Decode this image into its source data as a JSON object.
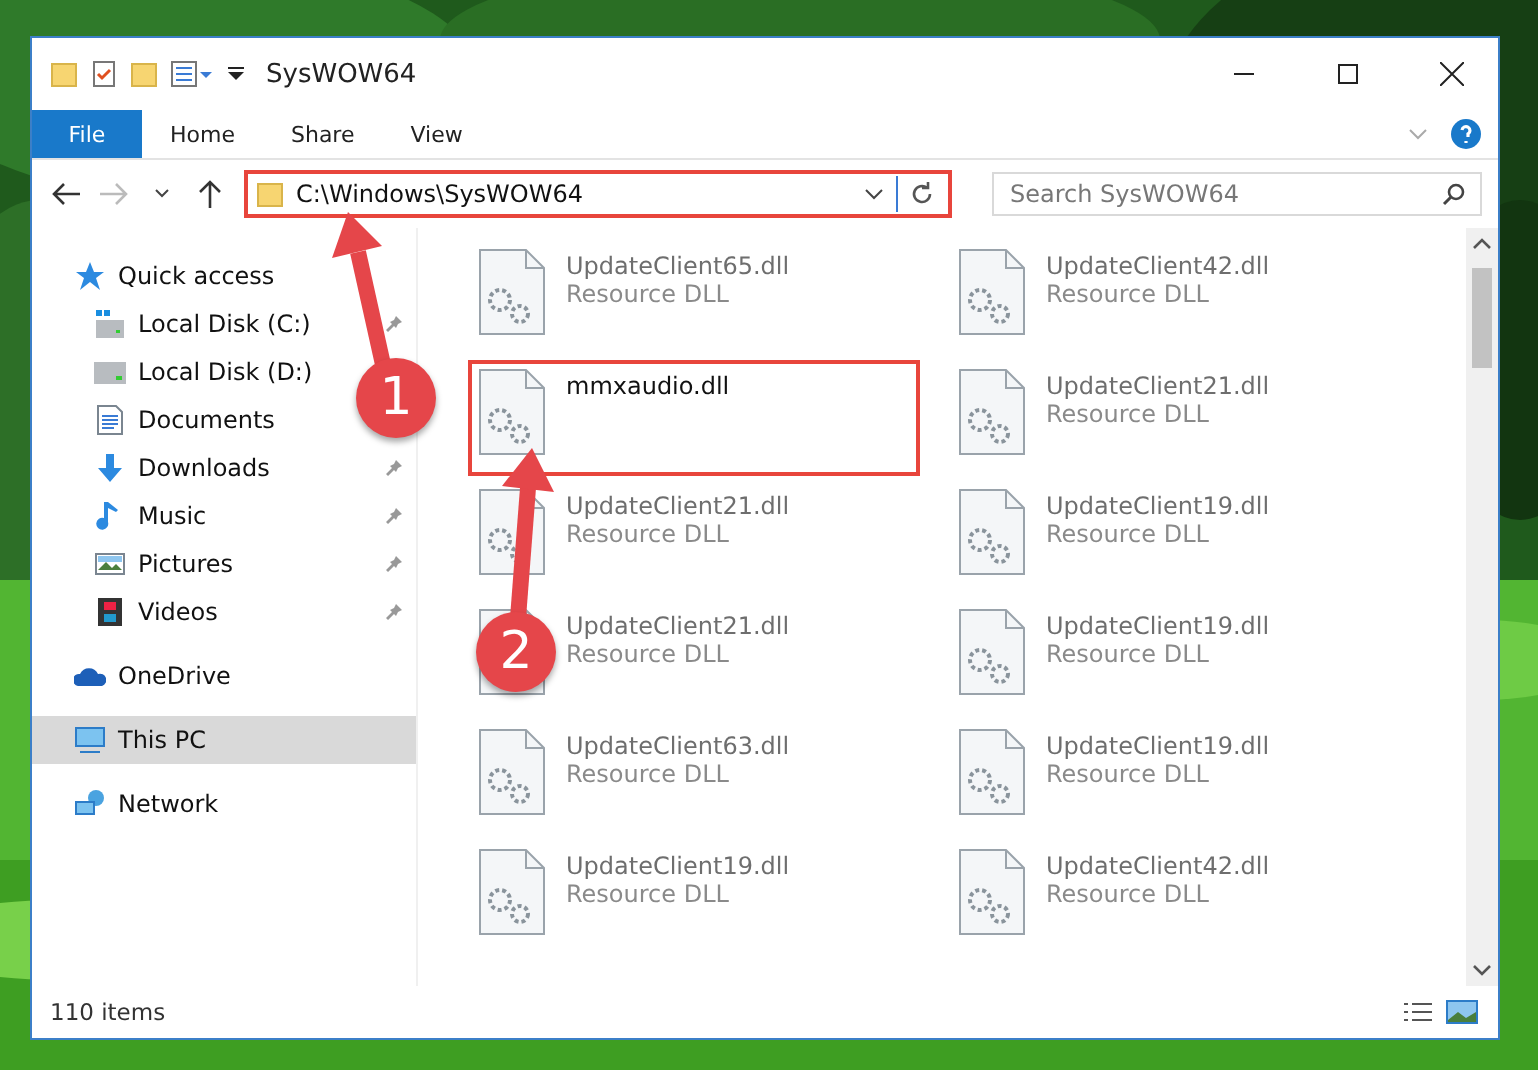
{
  "window": {
    "title": "SysWOW64"
  },
  "ribbon_tabs": [
    {
      "label": "File",
      "selected": true
    },
    {
      "label": "Home",
      "selected": false
    },
    {
      "label": "Share",
      "selected": false
    },
    {
      "label": "View",
      "selected": false
    }
  ],
  "address": {
    "path": "C:\\Windows\\SysWOW64",
    "highlighted": true
  },
  "search": {
    "placeholder": "Search SysWOW64"
  },
  "sidebar": {
    "items": [
      {
        "label": "Quick access",
        "kind": "star",
        "selected": false,
        "children": [
          {
            "label": "Local Disk (C:)",
            "kind": "drive-win",
            "pinned": true
          },
          {
            "label": "Local Disk (D:)",
            "kind": "drive",
            "pinned": false
          },
          {
            "label": "Documents",
            "kind": "document",
            "pinned": false
          },
          {
            "label": "Downloads",
            "kind": "download",
            "pinned": true
          },
          {
            "label": "Music",
            "kind": "music",
            "pinned": true
          },
          {
            "label": "Pictures",
            "kind": "pictures",
            "pinned": true
          },
          {
            "label": "Videos",
            "kind": "videos",
            "pinned": true
          }
        ]
      },
      {
        "label": "OneDrive",
        "kind": "cloud",
        "selected": false
      },
      {
        "label": "This PC",
        "kind": "pc",
        "selected": true
      },
      {
        "label": "Network",
        "kind": "network",
        "selected": false
      }
    ]
  },
  "files": [
    {
      "name": "UpdateClient65.dll",
      "type": "Resource DLL",
      "dimmed": true,
      "highlighted": false
    },
    {
      "name": "UpdateClient42.dll",
      "type": "Resource DLL",
      "dimmed": true,
      "highlighted": false
    },
    {
      "name": "mmxaudio.dll",
      "dimmed": false,
      "highlighted": true
    },
    {
      "name": "UpdateClient21.dll",
      "type": "Resource DLL",
      "dimmed": true,
      "highlighted": false
    },
    {
      "name": "UpdateClient21.dll",
      "type": "Resource DLL",
      "dimmed": true,
      "highlighted": false
    },
    {
      "name": "UpdateClient19.dll",
      "type": "Resource DLL",
      "dimmed": true,
      "highlighted": false
    },
    {
      "name": "UpdateClient21.dll",
      "type": "Resource DLL",
      "dimmed": true,
      "highlighted": false
    },
    {
      "name": "UpdateClient19.dll",
      "type": "Resource DLL",
      "dimmed": true,
      "highlighted": false
    },
    {
      "name": "UpdateClient63.dll",
      "type": "Resource DLL",
      "dimmed": true,
      "highlighted": false
    },
    {
      "name": "UpdateClient19.dll",
      "type": "Resource DLL",
      "dimmed": true,
      "highlighted": false
    },
    {
      "name": "UpdateClient19.dll",
      "type": "Resource DLL",
      "dimmed": true,
      "highlighted": false
    },
    {
      "name": "UpdateClient42.dll",
      "type": "Resource DLL",
      "dimmed": true,
      "highlighted": false
    }
  ],
  "status_bar": {
    "item_count": "110 items"
  },
  "annotations": [
    {
      "number": "1"
    },
    {
      "number": "2"
    }
  ]
}
